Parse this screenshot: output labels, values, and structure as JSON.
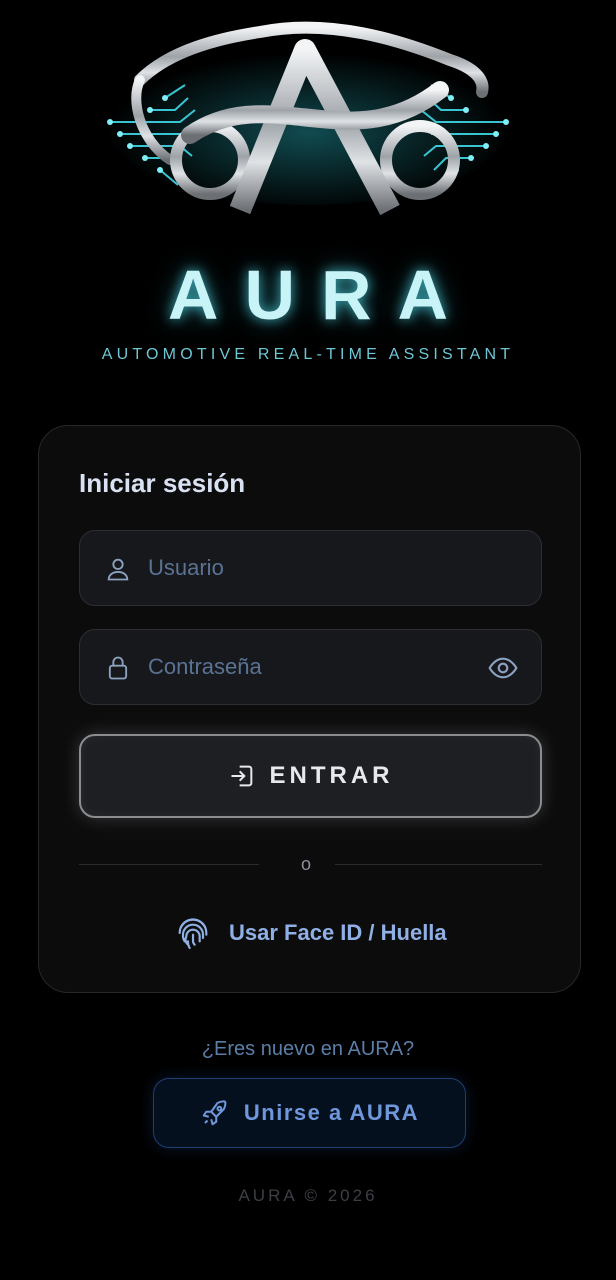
{
  "brand": {
    "name": "AURA",
    "tagline": "AUTOMOTIVE REAL-TIME ASSISTANT",
    "logo_icon": "aura-car-logo-icon"
  },
  "login": {
    "title": "Iniciar sesión",
    "username": {
      "placeholder": "Usuario",
      "value": "",
      "icon": "user-icon"
    },
    "password": {
      "placeholder": "Contraseña",
      "value": "",
      "icon": "lock-icon",
      "toggle_icon": "eye-icon"
    },
    "submit_label": "ENTRAR",
    "submit_icon": "sign-in-icon",
    "divider_text": "o",
    "biometric_label": "Usar Face ID / Huella",
    "biometric_icon": "fingerprint-icon"
  },
  "signup": {
    "prompt": "¿Eres nuevo en AURA?",
    "button_label": "Unirse a AURA",
    "button_icon": "rocket-icon"
  },
  "footer": {
    "text": "AURA © 2026"
  },
  "colors": {
    "background": "#000000",
    "card": "#0c0c0d",
    "glow_cyan": "#c8f4f8",
    "accent_blue": "#6f98dc"
  }
}
